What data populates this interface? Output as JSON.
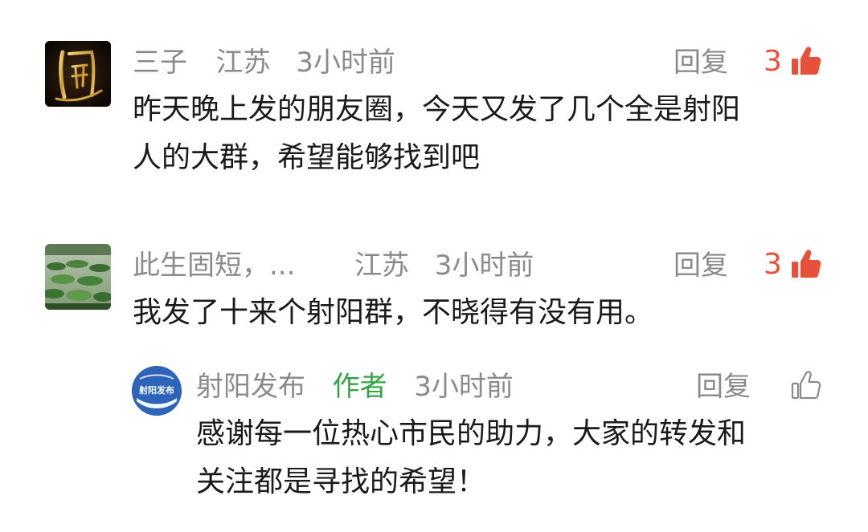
{
  "comments": [
    {
      "username": "三子",
      "location": "江苏",
      "time": "3小时前",
      "reply_label": "回复",
      "like_count": "3",
      "text_lines": [
        "昨天晚上发的朋友圈，今天又发了几个全是射阳",
        "人的大群，希望能够找到吧"
      ],
      "avatar_icon": "gold-calligraphy-avatar",
      "like_icon": "thumbs-up-filled-icon"
    },
    {
      "username": "此生固短，...",
      "location": "江苏",
      "time": "3小时前",
      "reply_label": "回复",
      "like_count": "3",
      "text_lines": [
        "我发了十来个射阳群，不晓得有没有用。"
      ],
      "avatar_icon": "lotus-pond-avatar",
      "like_icon": "thumbs-up-filled-icon"
    }
  ],
  "reply": {
    "username": "射阳发布",
    "author_tag": "作者",
    "time": "3小时前",
    "reply_label": "回复",
    "text_lines": [
      "感谢每一位热心市民的助力，大家的转发和",
      "关注都是寻找的希望！"
    ],
    "avatar_label": "射阳发布",
    "avatar_icon": "sheyang-fabu-logo-avatar",
    "like_icon": "thumbs-up-outline-icon"
  },
  "colors": {
    "accent_like": "#e8503a",
    "author_green": "#2fa745",
    "meta_gray": "#8a8a8a",
    "logo_blue": "#2d63b8"
  }
}
